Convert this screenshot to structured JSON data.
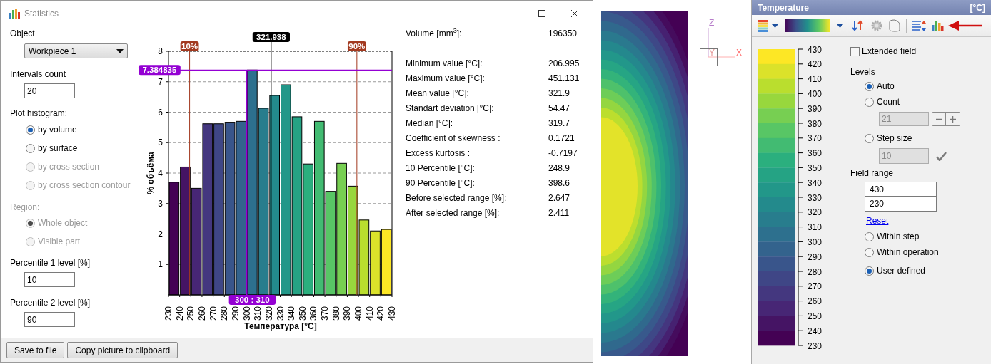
{
  "statistics_window": {
    "title": "Statistics",
    "object": {
      "label": "Object",
      "value": "Workpiece 1"
    },
    "intervals_count": {
      "label": "Intervals count",
      "value": "20"
    },
    "plot_histogram": {
      "label": "Plot histogram:",
      "options": [
        {
          "label": "by volume",
          "selected": true,
          "disabled": false
        },
        {
          "label": "by surface",
          "selected": false,
          "disabled": false
        },
        {
          "label": "by cross section",
          "selected": false,
          "disabled": true
        },
        {
          "label": "by cross section contour",
          "selected": false,
          "disabled": true
        }
      ]
    },
    "region": {
      "label": "Region:",
      "disabled": true,
      "options": [
        {
          "label": "Whole object",
          "selected": true,
          "disabled": true
        },
        {
          "label": "Visible part",
          "selected": false,
          "disabled": true
        }
      ]
    },
    "percentile_1": {
      "label": "Percentile 1 level [%]",
      "value": "10"
    },
    "percentile_2": {
      "label": "Percentile 2 level [%]",
      "value": "90"
    },
    "histogram": {
      "chart_data": {
        "type": "bar",
        "xlabel": "Температура [°C]",
        "ylabel": "% объёма",
        "x": [
          235,
          245,
          255,
          265,
          275,
          285,
          295,
          305,
          315,
          325,
          335,
          345,
          355,
          365,
          375,
          385,
          395,
          405,
          415,
          425
        ],
        "series": [
          {
            "values": [
              3.7,
              4.2,
              3.5,
              5.62,
              5.62,
              5.67,
              5.7,
              7.384835,
              6.13,
              6.55,
              6.9,
              5.85,
              4.3,
              5.7,
              3.4,
              4.32,
              3.57,
              2.46,
              2.1,
              2.15
            ]
          }
        ],
        "xlim": [
          230,
          430
        ],
        "ylim": [
          0,
          8
        ],
        "xticks": [
          230,
          240,
          250,
          260,
          270,
          280,
          290,
          300,
          310,
          320,
          330,
          340,
          350,
          360,
          370,
          380,
          390,
          400,
          410,
          420,
          430
        ],
        "yticks": [
          1,
          2,
          3,
          4,
          5,
          6,
          7,
          8
        ],
        "grid": true,
        "ref_lines": [
          {
            "axis": "x",
            "value": 248.9,
            "color": "#a2391f"
          },
          {
            "axis": "x",
            "value": 398.6,
            "color": "#a2391f"
          },
          {
            "axis": "x",
            "value": 321.938,
            "label": "321.938",
            "color": "#000000"
          },
          {
            "axis": "y",
            "value": 7.384835,
            "label": "7.384835",
            "color": "#9400d3"
          },
          {
            "axis": "x",
            "value": 300,
            "color": "#9400d3"
          }
        ],
        "annotations": [
          "10%",
          "90%",
          "300 : 310"
        ]
      }
    },
    "volume": {
      "label": "Volume [mm$^{3}$]:",
      "value": "196350"
    },
    "statistics": [
      {
        "label": "Minimum value [°C]:",
        "value": "206.995"
      },
      {
        "label": "Maximum value [°C]:",
        "value": "451.131"
      },
      {
        "label": "Mean value [°C]:",
        "value": "321.9"
      },
      {
        "label": "Standart deviation [°C]:",
        "value": "54.47"
      },
      {
        "label": "Median [°C]:",
        "value": "319.7"
      },
      {
        "label": "Coefficient of skewness :",
        "value": "0.1721"
      },
      {
        "label": "Excess kurtosis :",
        "value": "-0.7197"
      },
      {
        "label": "10 Percentile [°C]:",
        "value": "248.9"
      },
      {
        "label": "90 Percentile [°C]:",
        "value": "398.6"
      },
      {
        "label": "Before selected range [%]:",
        "value": "2.647"
      },
      {
        "label": "After selected range [%]:",
        "value": "2.411"
      }
    ],
    "buttons": [
      "Save to file",
      "Copy picture to clipboard"
    ]
  },
  "viewport": {
    "axis_labels": {
      "z": "Z",
      "x": "X",
      "y": "Y"
    }
  },
  "temperature_panel": {
    "title": "Temperature",
    "unit": "[°C]",
    "legend": {
      "labels": [
        "430",
        "420",
        "410",
        "400",
        "390",
        "380",
        "370",
        "360",
        "350",
        "340",
        "330",
        "320",
        "310",
        "300",
        "290",
        "280",
        "270",
        "260",
        "250",
        "240",
        "230"
      ]
    },
    "extended_field": {
      "label": "Extended field",
      "checked": false
    },
    "levels": {
      "label": "Levels",
      "options": [
        {
          "label": "Auto",
          "selected": true
        },
        {
          "label": "Count",
          "selected": false
        },
        {
          "label": "Step size",
          "selected": false
        }
      ],
      "count": {
        "value": "21",
        "disabled": true
      },
      "step_size": {
        "value": "10",
        "disabled": true
      }
    },
    "field_range": {
      "label": "Field range",
      "max": "430",
      "min": "230",
      "reset": "Reset",
      "options": [
        {
          "label": "Within step",
          "selected": false
        },
        {
          "label": "Within operation",
          "selected": false
        },
        {
          "label": "User defined",
          "selected": true
        }
      ]
    }
  }
}
